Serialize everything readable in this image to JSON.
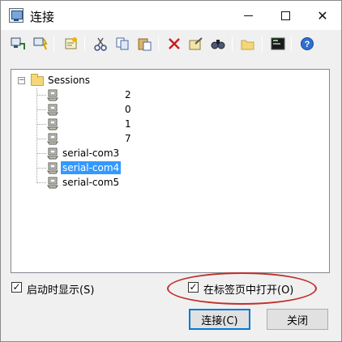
{
  "window": {
    "title": "连接",
    "minimize_label": "",
    "maximize_label": "",
    "close_label": "✕"
  },
  "toolbar": {
    "icons": [
      "connect-icon",
      "quick-connect-icon",
      "new-session-icon",
      "cut-icon",
      "copy-icon",
      "paste-icon",
      "delete-icon",
      "properties-icon",
      "find-icon",
      "new-folder-icon",
      "terminal-icon",
      "help-icon"
    ]
  },
  "tree": {
    "root": "Sessions",
    "items": [
      "2",
      "0",
      "1",
      "7",
      "serial-com3",
      "serial-com4",
      "serial-com5"
    ],
    "selected_index": 5,
    "expander_glyph": "−"
  },
  "options": {
    "show_on_startup": "启动时显示(S)",
    "show_on_startup_checked": true,
    "open_in_tab": "在标签页中打开(O)",
    "open_in_tab_checked": true,
    "check_glyph": "✓"
  },
  "buttons": {
    "connect": "连接(C)",
    "close": "关闭"
  },
  "colors": {
    "selection": "#3399ff",
    "highlight_oval": "#c0302a",
    "default_button_border": "#0078d7"
  }
}
